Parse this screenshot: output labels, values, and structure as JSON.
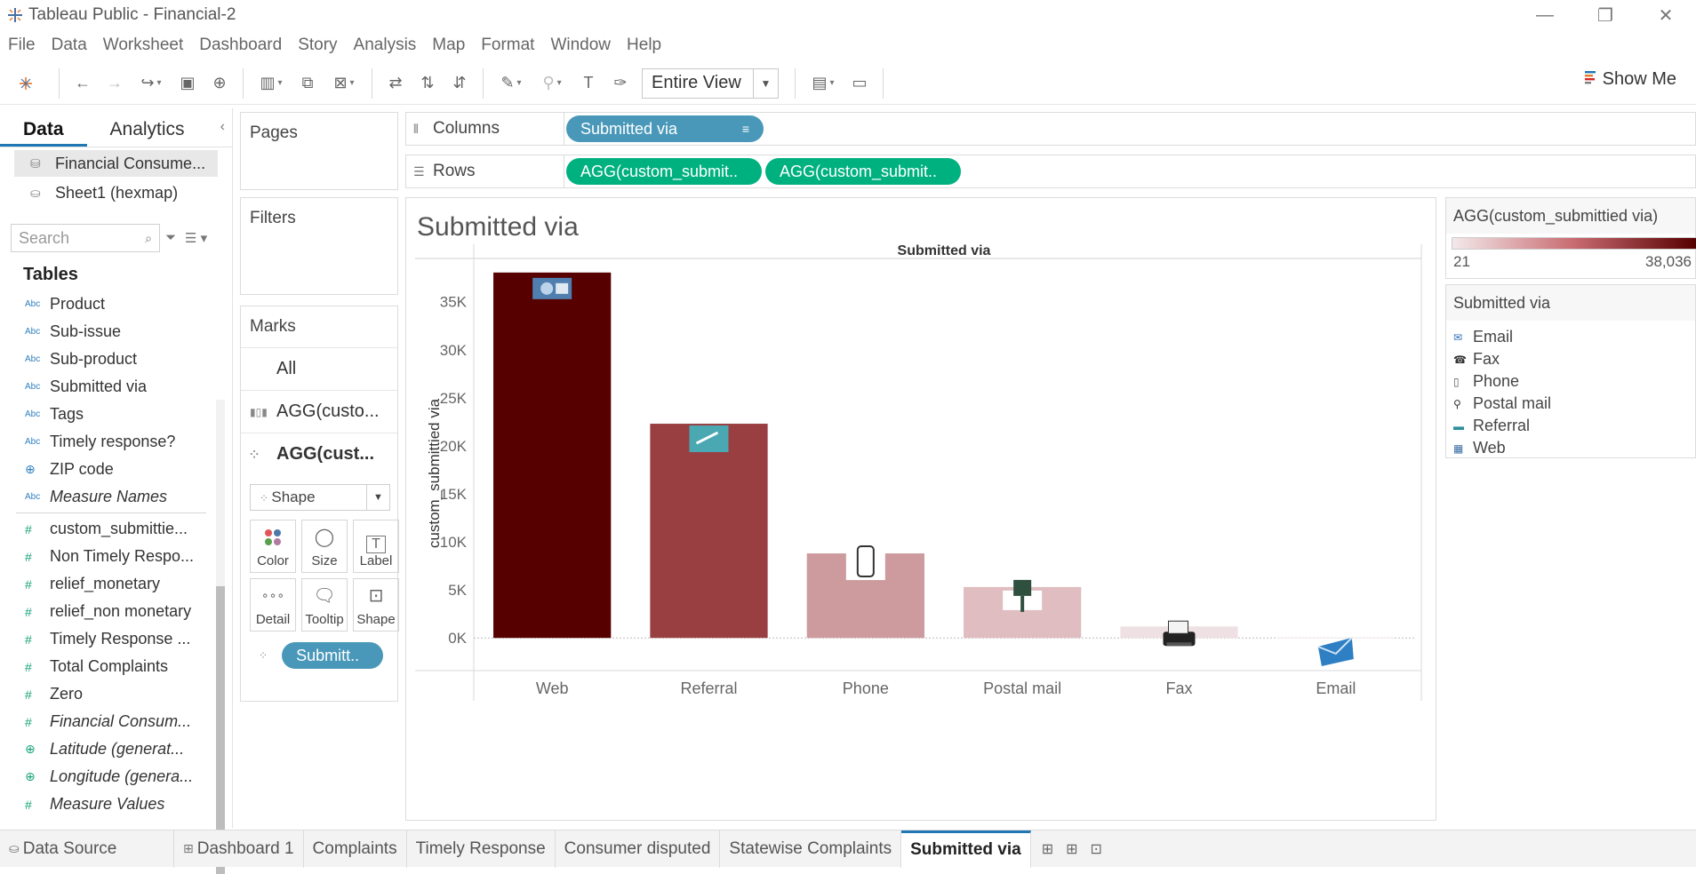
{
  "window": {
    "title": "Tableau Public - Financial-2",
    "controls": [
      "—",
      "❐",
      "✕"
    ]
  },
  "menu": [
    "File",
    "Data",
    "Worksheet",
    "Dashboard",
    "Story",
    "Analysis",
    "Map",
    "Format",
    "Window",
    "Help"
  ],
  "toolbar": {
    "view_select": "Entire View",
    "show_me": "Show Me"
  },
  "data_pane": {
    "tabs": [
      "Data",
      "Analytics"
    ],
    "datasources": [
      "Financial Consume...",
      "Sheet1 (hexmap)"
    ],
    "search_placeholder": "Search",
    "tables_heading": "Tables",
    "dimensions": [
      {
        "name": "Product",
        "type": "Abc"
      },
      {
        "name": "Sub-issue",
        "type": "Abc"
      },
      {
        "name": "Sub-product",
        "type": "Abc"
      },
      {
        "name": "Submitted via",
        "type": "Abc"
      },
      {
        "name": "Tags",
        "type": "Abc"
      },
      {
        "name": "Timely response?",
        "type": "Abc"
      },
      {
        "name": "ZIP code",
        "type": "geo"
      },
      {
        "name": "Measure Names",
        "type": "Abc"
      }
    ],
    "measures": [
      {
        "name": "custom_submittie...",
        "type": "#"
      },
      {
        "name": "Non Timely Respo...",
        "type": "#"
      },
      {
        "name": "relief_monetary",
        "type": "#"
      },
      {
        "name": "relief_non monetary",
        "type": "#"
      },
      {
        "name": "Timely Response ...",
        "type": "#"
      },
      {
        "name": "Total Complaints",
        "type": "#"
      },
      {
        "name": "Zero",
        "type": "#"
      },
      {
        "name": "Financial Consum...",
        "type": "#"
      },
      {
        "name": "Latitude (generat...",
        "type": "geo"
      },
      {
        "name": "Longitude (genera...",
        "type": "geo"
      },
      {
        "name": "Measure Values",
        "type": "#"
      }
    ]
  },
  "cards": {
    "pages": "Pages",
    "filters": "Filters",
    "marks": "Marks",
    "marks_rows": [
      "All",
      "AGG(custo...",
      "AGG(cust..."
    ],
    "mark_type": "Shape",
    "mark_buttons": [
      "Color",
      "Size",
      "Label",
      "Detail",
      "Tooltip",
      "Shape"
    ],
    "shape_pill": "Submitt.."
  },
  "shelves": {
    "columns_label": "Columns",
    "columns_pills": [
      "Submitted via"
    ],
    "rows_label": "Rows",
    "rows_pills": [
      "AGG(custom_submit..",
      "AGG(custom_submit.."
    ]
  },
  "viz": {
    "title": "Submitted via"
  },
  "chart_data": {
    "type": "bar",
    "title": "Submitted via",
    "xlabel": "",
    "ylabel": "custom_submittied via",
    "categories": [
      "Web",
      "Referral",
      "Phone",
      "Postal mail",
      "Fax",
      "Email"
    ],
    "values": [
      38036,
      22300,
      8800,
      5300,
      1200,
      21
    ],
    "ylim": [
      -3400,
      39500
    ],
    "yticks": [
      0,
      5000,
      10000,
      15000,
      20000,
      25000,
      30000,
      35000
    ],
    "ytick_labels": [
      "0K",
      "5K",
      "10K",
      "15K",
      "20K",
      "25K",
      "30K",
      "35K"
    ],
    "colors": [
      "#560000",
      "#9a3f41",
      "#cd9b9e",
      "#dfbdc0",
      "#efe1e3",
      "#f4ecee"
    ],
    "grid": false,
    "shape_icons": [
      "web-icon",
      "referral-icon",
      "phone-icon",
      "postal-mail-icon",
      "fax-icon",
      "email-icon"
    ],
    "legend": "right"
  },
  "legends": {
    "color_title": "AGG(custom_submittied via)",
    "color_min": "21",
    "color_max": "38,036",
    "shape_title": "Submitted via",
    "shape_items": [
      "Email",
      "Fax",
      "Phone",
      "Postal mail",
      "Referral",
      "Web"
    ]
  },
  "bottom_tabs": {
    "datasource": "Data Source",
    "sheets": [
      "Dashboard 1",
      "Complaints",
      "Timely Response",
      "Consumer disputed",
      "Statewise Complaints",
      "Submitted via"
    ],
    "active": "Submitted via"
  },
  "colors": {
    "accent": "#1f77b4",
    "pill_blue": "#4a98b9",
    "pill_green": "#00b180"
  }
}
